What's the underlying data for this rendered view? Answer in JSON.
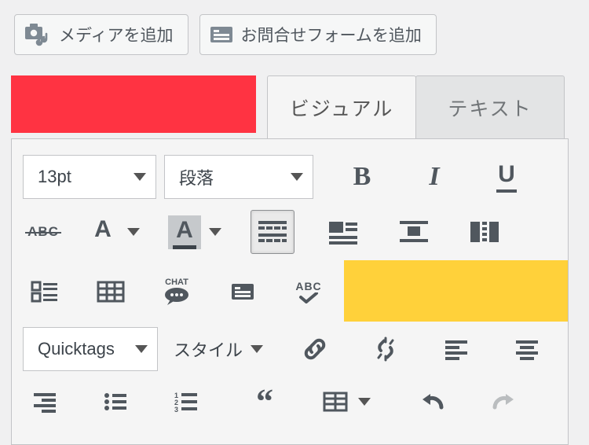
{
  "top_buttons": {
    "add_media": "メディアを追加",
    "add_contact_form": "お問合せフォームを追加"
  },
  "tabs": {
    "visual": "ビジュアル",
    "text": "テキスト"
  },
  "toolbar": {
    "fontsize": "13pt",
    "block_format": "段落",
    "bold": "B",
    "italic": "I",
    "underline": "U",
    "strike": "ABC",
    "textcolor_letter": "A",
    "textcolor_underline": "#3c434a",
    "bgcolor_letter": "A",
    "bgcolor_underline": "#3c434a",
    "chat_label": "CHAT",
    "abc_check": "ABC",
    "quicktags": "Quicktags",
    "style_label": "スタイル"
  },
  "highlights": {
    "red": "#ff3342",
    "yellow": "#ffd13a"
  }
}
